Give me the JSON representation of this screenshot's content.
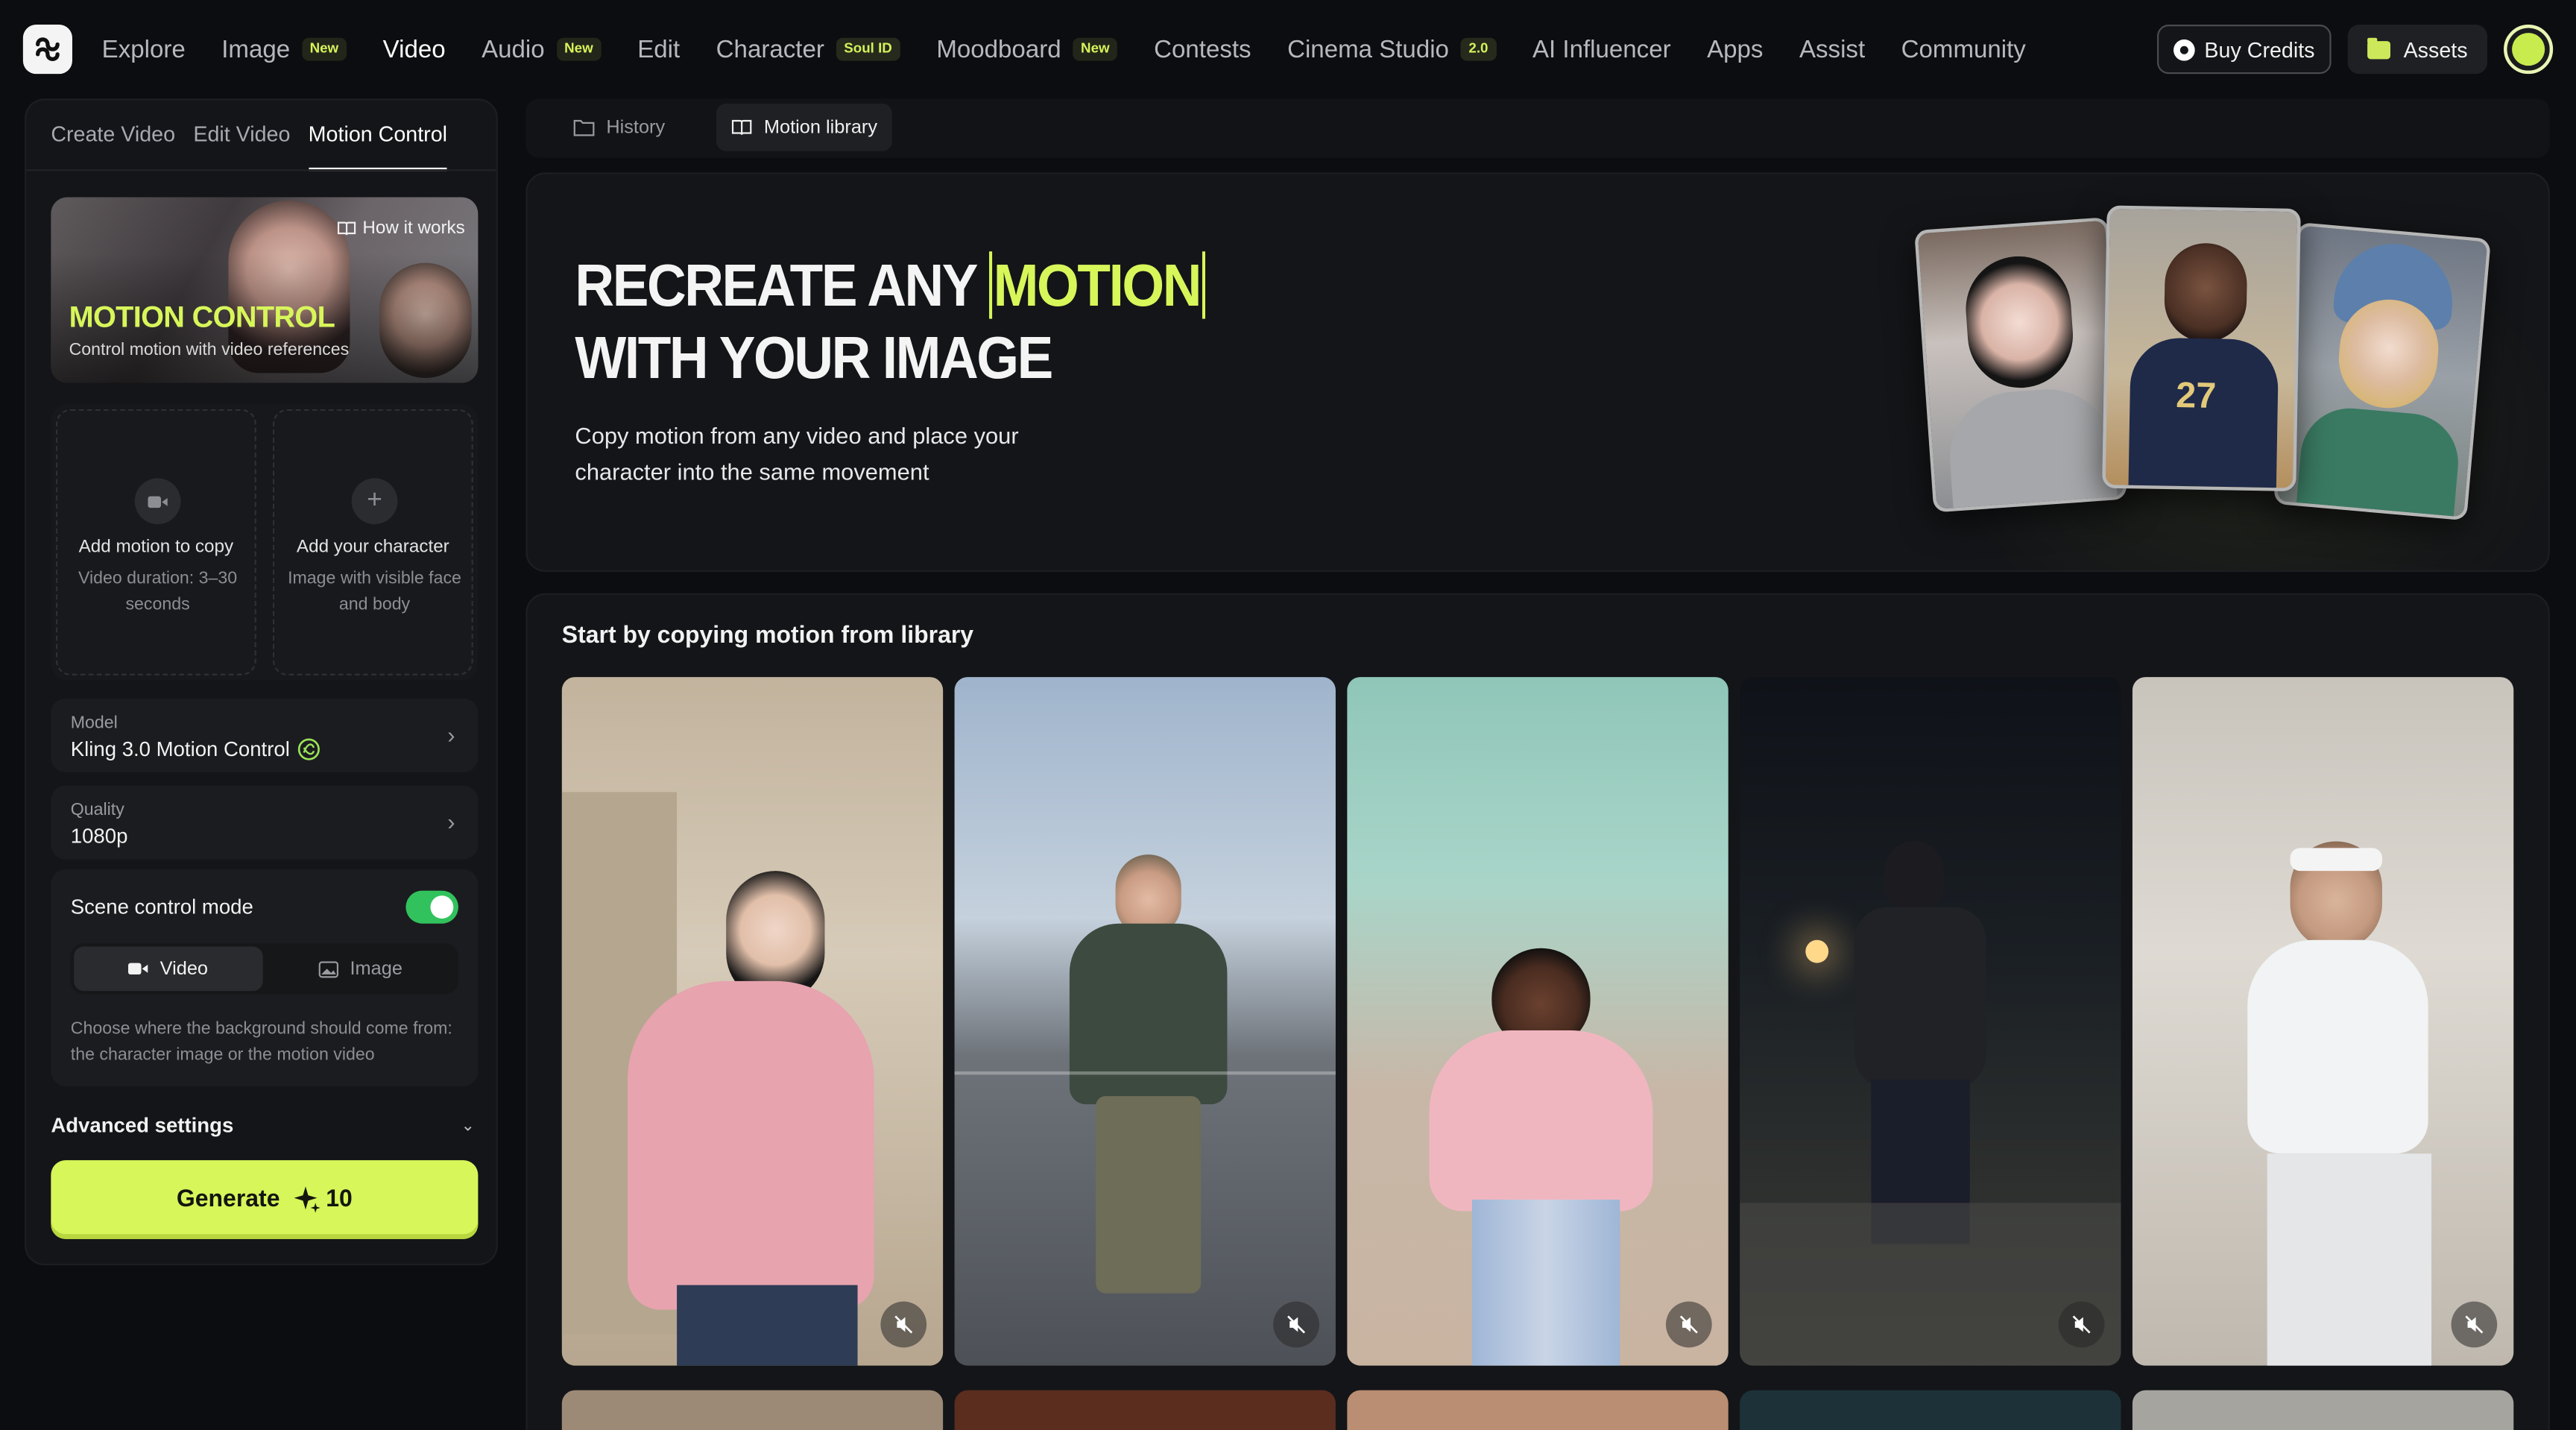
{
  "nav": {
    "items": [
      {
        "label": "Explore",
        "badge": ""
      },
      {
        "label": "Image",
        "badge": "New"
      },
      {
        "label": "Video",
        "badge": "",
        "active": true
      },
      {
        "label": "Audio",
        "badge": "New"
      },
      {
        "label": "Edit",
        "badge": ""
      },
      {
        "label": "Character",
        "badge": "Soul ID"
      },
      {
        "label": "Moodboard",
        "badge": "New"
      },
      {
        "label": "Contests",
        "badge": ""
      },
      {
        "label": "Cinema Studio",
        "badge": "2.0"
      },
      {
        "label": "AI Influencer",
        "badge": ""
      },
      {
        "label": "Apps",
        "badge": ""
      },
      {
        "label": "Assist",
        "badge": ""
      },
      {
        "label": "Community",
        "badge": ""
      }
    ],
    "buy_credits": "Buy Credits",
    "assets": "Assets"
  },
  "left": {
    "tabs": [
      "Create Video",
      "Edit Video",
      "Motion Control"
    ],
    "hero": {
      "how_it_works": "How it works",
      "title": "MOTION CONTROL",
      "subtitle": "Control motion with video references"
    },
    "upload_motion": {
      "title": "Add motion to copy",
      "desc": "Video duration: 3–30 seconds"
    },
    "upload_character": {
      "title": "Add your character",
      "desc": "Image with visible face and body"
    },
    "model": {
      "label": "Model",
      "value": "Kling 3.0 Motion Control"
    },
    "quality": {
      "label": "Quality",
      "value": "1080p"
    },
    "scene": {
      "title": "Scene control mode",
      "enabled": true,
      "options": [
        "Video",
        "Image"
      ],
      "selected": "Video",
      "help": "Choose where the background should come from: the character image or the motion video"
    },
    "advanced": "Advanced settings",
    "generate": {
      "label": "Generate",
      "cost": "10"
    }
  },
  "main": {
    "tabs": [
      "History",
      "Motion library"
    ],
    "active_tab": "Motion library",
    "hero": {
      "line1_pre": "RECREATE ANY ",
      "line1_hl": "MOTION",
      "line2": "WITH YOUR IMAGE",
      "desc": "Copy motion from any video and place your character into the same movement"
    },
    "library_title": "Start by copying motion from library"
  },
  "colors": {
    "accent": "#d7f65a",
    "background": "#0c0d10",
    "panel": "#141518",
    "toggle_on": "#32c25d"
  }
}
